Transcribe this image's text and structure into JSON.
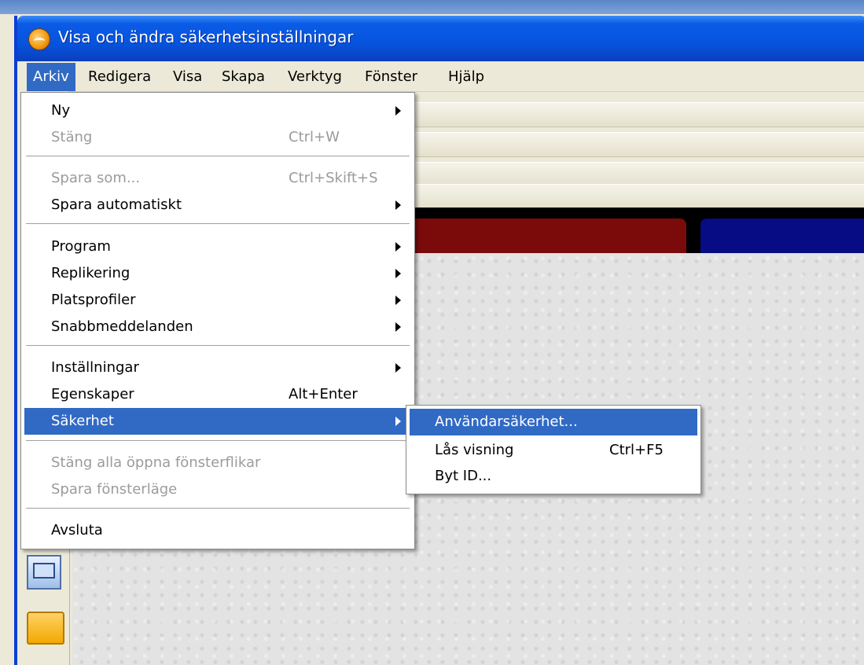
{
  "window": {
    "title": "Visa och ändra säkerhetsinställningar",
    "icon": "app-orb-icon"
  },
  "menubar": {
    "items": [
      {
        "label": "Arkiv",
        "active": true
      },
      {
        "label": "Redigera"
      },
      {
        "label": "Visa"
      },
      {
        "label": "Skapa"
      },
      {
        "label": "Verktyg"
      },
      {
        "label": "Fönster"
      },
      {
        "label": "Hjälp"
      }
    ]
  },
  "arkiv_menu": {
    "items": [
      {
        "label": "Ny",
        "submenu": true
      },
      {
        "label": "Stäng",
        "shortcut": "Ctrl+W",
        "disabled": true
      },
      {
        "label": "Spara som...",
        "shortcut": "Ctrl+Skift+S",
        "disabled": true
      },
      {
        "label": "Spara automatiskt",
        "submenu": true
      },
      {
        "label": "Program",
        "submenu": true
      },
      {
        "label": "Replikering",
        "submenu": true
      },
      {
        "label": "Platsprofiler",
        "submenu": true
      },
      {
        "label": "Snabbmeddelanden",
        "submenu": true
      },
      {
        "label": "Inställningar",
        "submenu": true
      },
      {
        "label": "Egenskaper",
        "shortcut": "Alt+Enter"
      },
      {
        "label": "Säkerhet",
        "submenu": true,
        "highlighted": true
      },
      {
        "label": "Stäng alla öppna fönsterflikar",
        "disabled": true
      },
      {
        "label": "Spara fönsterläge",
        "disabled": true
      },
      {
        "label": "Avsluta"
      }
    ]
  },
  "sakerhet_submenu": {
    "items": [
      {
        "label": "Användarsäkerhet...",
        "highlighted": true
      },
      {
        "label": "Lås visning",
        "shortcut": "Ctrl+F5"
      },
      {
        "label": "Byt ID..."
      }
    ]
  },
  "colors": {
    "title_bar": "#0654de",
    "menu_highlight": "#316ac5",
    "disabled_text": "#9b9b9b",
    "tab_red": "#7b0b0b",
    "tab_blue": "#070b84"
  }
}
